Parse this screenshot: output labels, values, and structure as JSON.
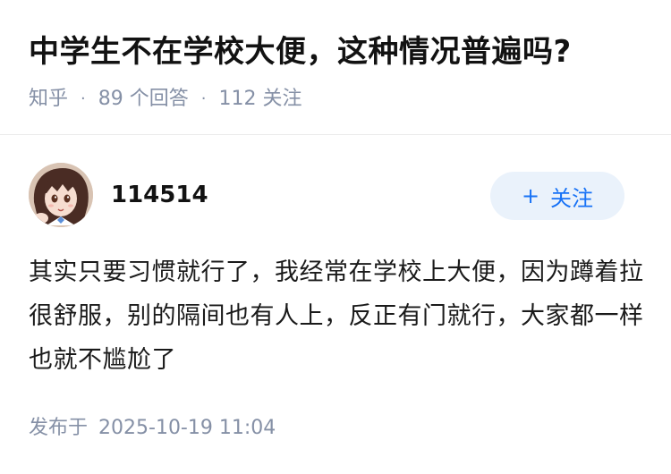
{
  "question": {
    "title": "中学生不在学校大便，这种情况普遍吗?",
    "site": "知乎",
    "dot": "·",
    "answer_count": "89 个回答",
    "follower_count": "112 关注"
  },
  "answer": {
    "author": "114514",
    "follow_label": "关注",
    "follow_icon": "plus-icon",
    "content": "其实只要习惯就行了，我经常在学校上大便，因为蹲着拉很舒服，别的隔间也有人上，反正有门就行，大家都一样也就不尴尬了",
    "published_label": "发布于",
    "published_time": "2025-10-19 11:04"
  },
  "colors": {
    "accent": "#1772f6",
    "follow_bg": "#eaf2fb",
    "meta_text": "#8590a6",
    "title_text": "#121212"
  }
}
